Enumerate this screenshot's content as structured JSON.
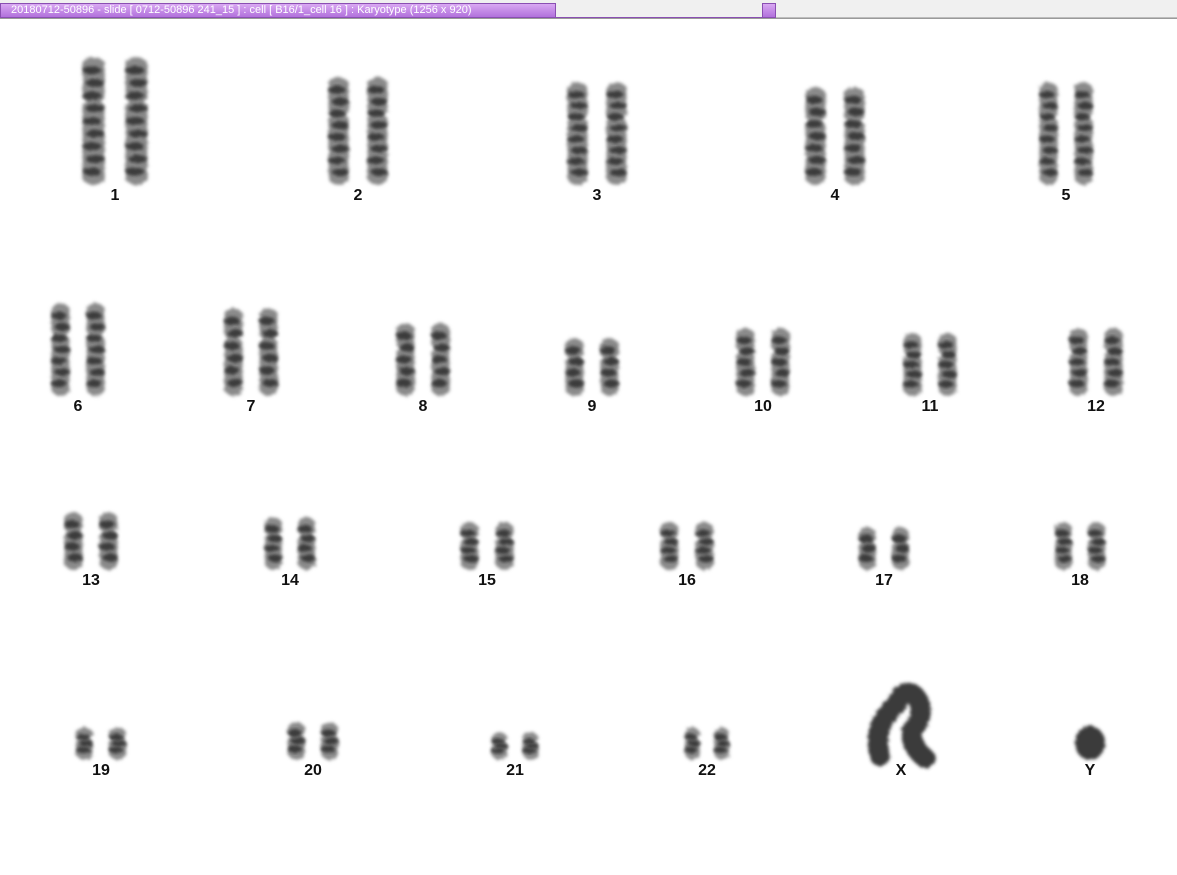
{
  "window": {
    "title": "20180712-50896 - slide [ 0712-50896 241_15 ] : cell [ B16/1_cell 16 ] : Karyotype  (1256 x 920)"
  },
  "karyogram": {
    "chromosomes": [
      {
        "label": "1"
      },
      {
        "label": "2"
      },
      {
        "label": "3"
      },
      {
        "label": "4"
      },
      {
        "label": "5"
      },
      {
        "label": "6"
      },
      {
        "label": "7"
      },
      {
        "label": "8"
      },
      {
        "label": "9"
      },
      {
        "label": "10"
      },
      {
        "label": "11"
      },
      {
        "label": "12"
      },
      {
        "label": "13"
      },
      {
        "label": "14"
      },
      {
        "label": "15"
      },
      {
        "label": "16"
      },
      {
        "label": "17"
      },
      {
        "label": "18"
      },
      {
        "label": "19"
      },
      {
        "label": "20"
      },
      {
        "label": "21"
      },
      {
        "label": "22"
      },
      {
        "label": "X"
      },
      {
        "label": "Y"
      }
    ],
    "colors": {
      "chromatin": "#3a3a3a",
      "label": "#111111"
    }
  }
}
